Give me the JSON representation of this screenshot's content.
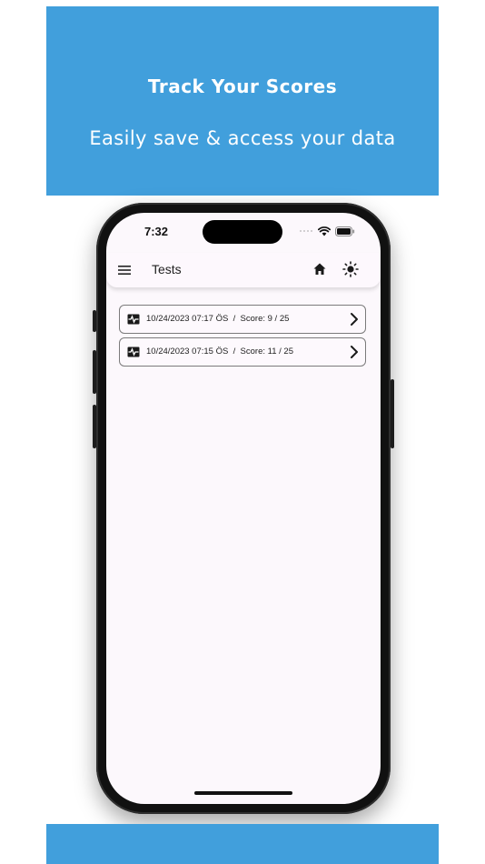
{
  "banner": {
    "title": "Track Your Scores",
    "subtitle": "Easily save & access your data"
  },
  "status_bar": {
    "time": "7:32",
    "icons": [
      "cellular-icon",
      "wifi-icon",
      "battery-icon"
    ]
  },
  "app_bar": {
    "title": "Tests",
    "icons": [
      "menu-icon",
      "home-icon",
      "theme-sun-icon"
    ]
  },
  "tests": [
    {
      "date": "10/24/2023 07:17 ÖS",
      "score": "Score: 9 / 25"
    },
    {
      "date": "10/24/2023 07:15 ÖS",
      "score": "Score: 11 / 25"
    }
  ],
  "colors": {
    "banner": "#419fdc",
    "screen_bg": "#fcf8fc",
    "phone_frame": "#111111"
  }
}
